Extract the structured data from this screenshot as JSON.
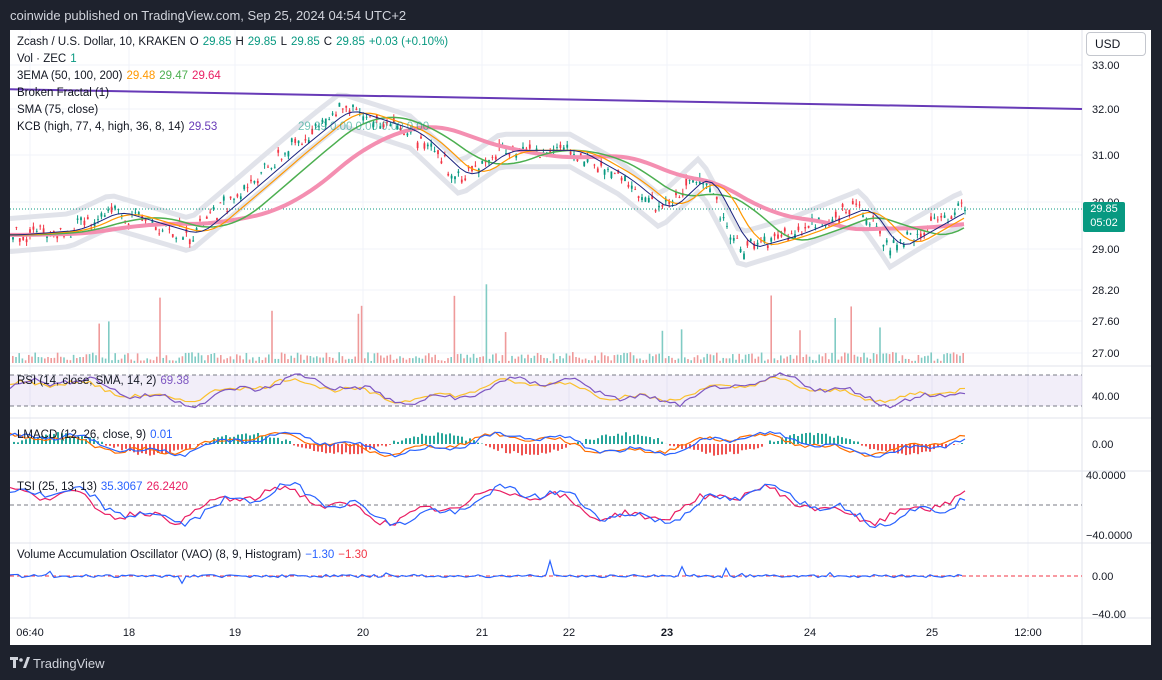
{
  "header": {
    "publisher_line": "coinwide published on TradingView.com, Sep 25, 2024 04:54 UTC+2"
  },
  "footer": {
    "brand": "TradingView"
  },
  "currency_button": "USD",
  "legend": {
    "symbol": "Zcash / U.S. Dollar, 10, KRAKEN",
    "o_label": "O",
    "o": "29.85",
    "h_label": "H",
    "h": "29.85",
    "l_label": "L",
    "l": "29.85",
    "c_label": "C",
    "c": "29.85",
    "change": "+0.03 (+0.10%)",
    "vol_label": "Vol · ZEC",
    "vol": "1",
    "ema_label": "3EMA (50, 100, 200)",
    "ema50": "29.48",
    "ema100": "29.47",
    "ema200": "29.64",
    "fractal_label": "Broken Fractal (1)",
    "sma_label": "SMA (75, close)",
    "kcb_label": "KCB (high, 77, 4, high, 36, 8, 14)",
    "kcb_value": "29.53",
    "faint_values": "29.29   0.00   0.00   0.00   0.00",
    "rsi_label": "RSI (14, close, SMA, 14, 2)",
    "rsi_value": "69.38",
    "macd_label": "LMACD (12, 26, close, 9)",
    "macd_value": "0.01",
    "tsi_label": "TSI (25, 13, 13)",
    "tsi_value": "35.3067",
    "tsi_signal": "26.2420",
    "vao_label": "Volume Accumulation Oscillator (VAO) (8, 9, Histogram)",
    "vao_value": "−1.30",
    "vao_value2": "−1.30"
  },
  "price_tag": {
    "price": "29.85",
    "countdown": "05:02"
  },
  "colors": {
    "up": "#089981",
    "down": "#f23645",
    "trendline": "#673ab7",
    "sma": "#f48fb1",
    "ema50": "#ff9800",
    "ema100": "#4caf50",
    "ema200": "#e91e63",
    "rsi": "#7e57c2",
    "macd": "#2962ff",
    "macd_signal": "#ff6d00",
    "tsi": "#2962ff",
    "tsi_signal": "#e91e63"
  },
  "chart_data": {
    "type": "candlestick",
    "x_ticks": [
      "06:40",
      "18",
      "19",
      "20",
      "21",
      "22",
      "23",
      "24",
      "25",
      "12:00"
    ],
    "price_ticks": [
      "33.00",
      "32.00",
      "31.00",
      "30.00",
      "29.00",
      "28.20",
      "27.60",
      "27.00"
    ],
    "ylim": [
      26.9,
      33.4
    ],
    "close_path": [
      {
        "x": "06:40",
        "y": 29.3
      },
      {
        "x": "18",
        "y": 29.4
      },
      {
        "x": "18",
        "y": 29.8
      },
      {
        "x": "19",
        "y": 29.3
      },
      {
        "x": "19",
        "y": 30.2
      },
      {
        "x": "19",
        "y": 31.3
      },
      {
        "x": "20",
        "y": 32.0
      },
      {
        "x": "20",
        "y": 31.5
      },
      {
        "x": "21",
        "y": 30.5
      },
      {
        "x": "21",
        "y": 31.1
      },
      {
        "x": "22",
        "y": 31.1
      },
      {
        "x": "22",
        "y": 30.5
      },
      {
        "x": "23",
        "y": 29.8
      },
      {
        "x": "23",
        "y": 30.6
      },
      {
        "x": "23",
        "y": 29.0
      },
      {
        "x": "24",
        "y": 29.3
      },
      {
        "x": "24",
        "y": 29.9
      },
      {
        "x": "25",
        "y": 29.0
      },
      {
        "x": "25",
        "y": 29.85
      }
    ],
    "trendline": {
      "start": 32.45,
      "end": 32.0
    },
    "rsi_ticks": [
      "40.00"
    ],
    "macd_ticks": [
      "0.00"
    ],
    "tsi_ticks": [
      "40.0000",
      "−40.0000"
    ],
    "vao_ticks": [
      "0.00",
      "−40.00"
    ]
  }
}
